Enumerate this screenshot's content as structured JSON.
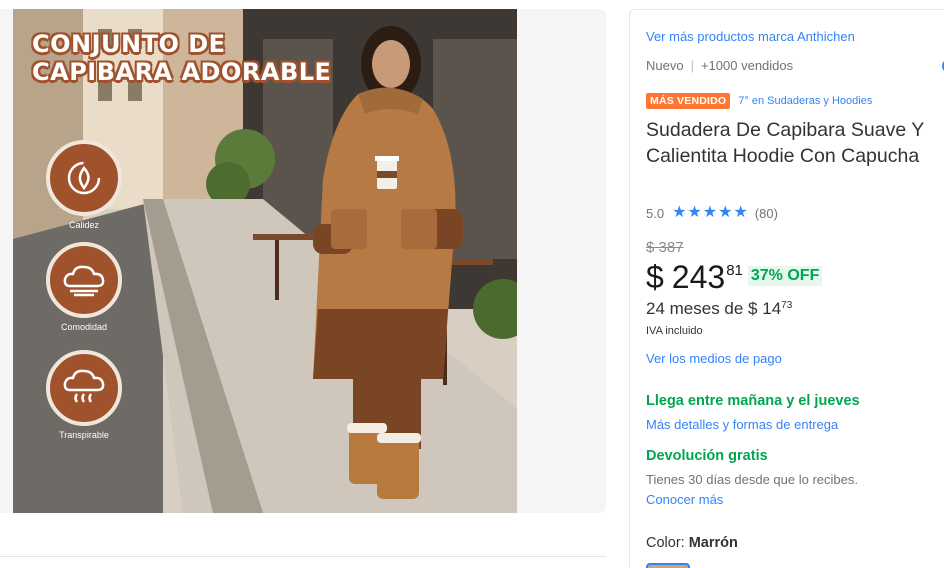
{
  "gallery": {
    "banner_line1": "CONJUNTO DE",
    "banner_line2": "CAPIBARA ADORABLE",
    "features": [
      {
        "icon": "warmth-fire-icon",
        "label": "Calidez"
      },
      {
        "icon": "comfort-cloud-icon",
        "label": "Comodidad"
      },
      {
        "icon": "breathable-cloud-icon",
        "label": "Transpirable"
      }
    ]
  },
  "product": {
    "brand_link": "Ver más productos marca Anthichen",
    "condition": "Nuevo",
    "sold": "+1000 vendidos",
    "badge": "MÁS VENDIDO",
    "rank": "7° en Sudaderas y Hoodies",
    "title": "Sudadera De Capibara Suave Y Calientita Hoodie Con Capucha",
    "rating_value": "5.0",
    "rating_stars": 5,
    "rating_count": "(80)",
    "old_price": "$ 387",
    "currency": "$",
    "price_int": "243",
    "price_cents": "81",
    "discount": "37% OFF",
    "installments_text": "24 meses de $ 14",
    "installments_cents": "73",
    "iva": "IVA incluido",
    "payment_link": "Ver los medios de pago",
    "delivery": "Llega entre mañana y el jueves",
    "delivery_link": "Más detalles y formas de entrega",
    "returns": "Devolución gratis",
    "returns_desc": "Tienes 30 días desde que lo recibes.",
    "returns_link": "Conocer más",
    "color_label": "Color:",
    "color_value": "Marrón"
  },
  "colors": {
    "accent_blue": "#3483fa",
    "green": "#00a650",
    "badge_orange": "#ff7733",
    "feature_brown": "#a0522d"
  }
}
